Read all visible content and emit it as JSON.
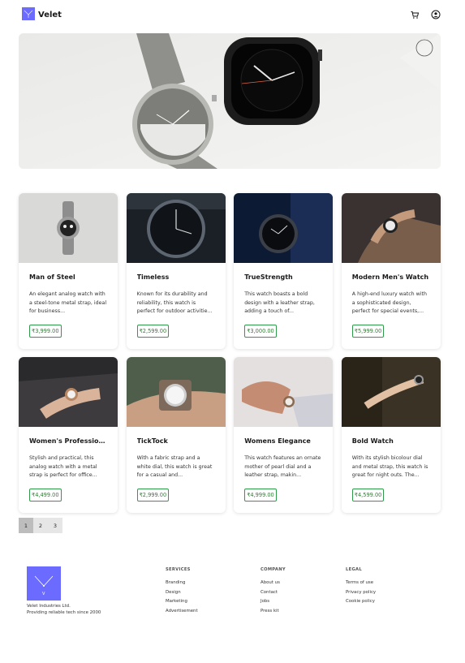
{
  "header": {
    "brand": "Velet",
    "icons": [
      "cart-icon",
      "user-icon"
    ]
  },
  "hero": {
    "image": "watches-hero-image"
  },
  "products": [
    {
      "title": "Man of Steel",
      "desc": "An elegant analog watch with a steel-tone metal strap, ideal for business...",
      "price": "₹3,999.00",
      "image": "steel-watch-image"
    },
    {
      "title": "Timeless",
      "desc": "Known for its durability and reliability, this watch is perfect for outdoor activitie...",
      "price": "₹2,599.00",
      "image": "black-watch-image"
    },
    {
      "title": "TrueStrength",
      "desc": "This watch boasts a bold design with a leather strap, adding a touch of...",
      "price": "₹3,000.00",
      "image": "dark-watch-image"
    },
    {
      "title": "Modern Men's Watch",
      "desc": "A high-end luxury watch with a sophisticated design, perfect for special events,...",
      "price": "₹5,999.00",
      "image": "wrist-watch-image"
    },
    {
      "title": "Women's Profession...",
      "desc": "Stylish and practical, this analog watch with a metal strap is perfect for office...",
      "price": "₹4,499.00",
      "image": "womens-watch-image"
    },
    {
      "title": "TickTock",
      "desc": "With a fabric strap and a white dial, this watch is great for a casual and...",
      "price": "₹2,999.00",
      "image": "fabric-watch-image"
    },
    {
      "title": "Womens Elegance",
      "desc": "This watch features an ornate mother of pearl dial and a leather strap, makin...",
      "price": "₹4,999.00",
      "image": "henna-watch-image"
    },
    {
      "title": "Bold Watch",
      "desc": "With its stylish bicolour dial and metal strap, this watch is great for night outs. The...",
      "price": "₹4,599.00",
      "image": "bold-watch-image"
    }
  ],
  "pagination": {
    "pages": [
      "1",
      "2",
      "3"
    ],
    "current": "1"
  },
  "footer": {
    "company_line1": "Velet Industries Ltd.",
    "company_line2": "Providing reliable tech since 2000",
    "services": {
      "heading": "SERVICES",
      "items": [
        "Branding",
        "Design",
        "Marketing",
        "Advertisement"
      ]
    },
    "company": {
      "heading": "COMPANY",
      "items": [
        "About us",
        "Contact",
        "Jobs",
        "Press kit"
      ]
    },
    "legal": {
      "heading": "LEGAL",
      "items": [
        "Terms of use",
        "Privacy policy",
        "Cookie policy"
      ]
    }
  },
  "colors": {
    "brand": "#6b6bff",
    "price": "#2e9a4a"
  }
}
